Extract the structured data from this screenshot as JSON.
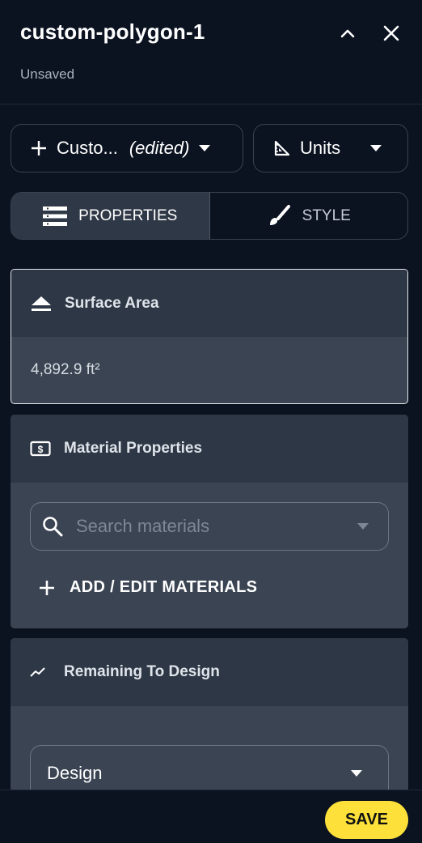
{
  "header": {
    "title": "custom-polygon-1",
    "subtitle": "Unsaved"
  },
  "toolbar": {
    "custom_label": "Custo...",
    "custom_edited": "(edited)",
    "units_label": "Units"
  },
  "tabs": [
    {
      "label": "PROPERTIES",
      "active": true
    },
    {
      "label": "STYLE",
      "active": false
    }
  ],
  "surface_area": {
    "title": "Surface Area",
    "value": "4,892.9 ft²"
  },
  "material_properties": {
    "title": "Material Properties",
    "search_placeholder": "Search materials",
    "add_label": "ADD / EDIT MATERIALS"
  },
  "remaining": {
    "title": "Remaining To Design",
    "select_value": "Design"
  },
  "footer": {
    "save_label": "SAVE"
  },
  "colors": {
    "background": "#0b1220",
    "card_header": "#2e3745",
    "card_body": "#3a4452",
    "save_accent": "#fde13a"
  }
}
